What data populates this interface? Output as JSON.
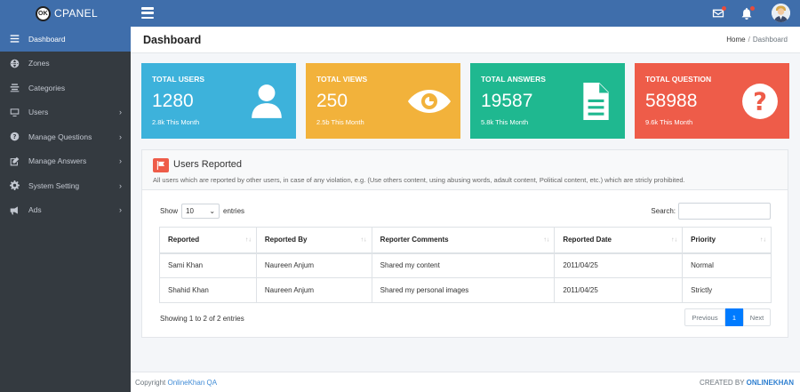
{
  "brand": {
    "logo_text": "OK",
    "name": "CPANEL"
  },
  "sidebar": {
    "items": [
      {
        "label": "Dashboard",
        "icon": "menu-icon",
        "arrow": ""
      },
      {
        "label": "Zones",
        "icon": "globe-icon",
        "arrow": ""
      },
      {
        "label": "Categories",
        "icon": "list-icon",
        "arrow": ""
      },
      {
        "label": "Users",
        "icon": "monitor-icon",
        "arrow": "›"
      },
      {
        "label": "Manage Questions",
        "icon": "question-icon",
        "arrow": "›"
      },
      {
        "label": "Manage Answers",
        "icon": "edit-icon",
        "arrow": "›"
      },
      {
        "label": "System Setting",
        "icon": "gear-icon",
        "arrow": "›"
      },
      {
        "label": "Ads",
        "icon": "bullhorn-icon",
        "arrow": "›"
      }
    ]
  },
  "header": {
    "title": "Dashboard",
    "breadcrumb_home": "Home",
    "breadcrumb_sep": "/",
    "breadcrumb_current": "Dashboard"
  },
  "cards": [
    {
      "label": "TOTAL USERS",
      "value": "1280",
      "sub": "2.8k This Month",
      "color": "#3db2db",
      "icon": "user-icon"
    },
    {
      "label": "TOTAL VIEWS",
      "value": "250",
      "sub": "2.5b This Month",
      "color": "#f2b23b",
      "icon": "eye-icon"
    },
    {
      "label": "TOTAL ANSWERS",
      "value": "19587",
      "sub": "5.8k This Month",
      "color": "#1fb890",
      "icon": "document-icon"
    },
    {
      "label": "TOTAL QUESTION",
      "value": "58988",
      "sub": "9.6k This Month",
      "color": "#ee5c49",
      "icon": "question-circle-icon"
    }
  ],
  "reported": {
    "title": "Users Reported",
    "description": "All users which are reported by other users, in case of any violation, e.g. (Use others content, using abusing words, adault content, Political content, etc.) which are stricly prohibited.",
    "show_label": "Show",
    "entries_value": "10",
    "entries_label": "entries",
    "search_label": "Search:",
    "columns": [
      "Reported",
      "Reported By",
      "Reporter Comments",
      "Reported Date",
      "Priority"
    ],
    "sort_glyph": "↑↓",
    "rows": [
      [
        "Sami Khan",
        "Naureen Anjum",
        "Shared my content",
        "2011/04/25",
        "Normal"
      ],
      [
        "Shahid Khan",
        "Naureen Anjum",
        "Shared my personal images",
        "2011/04/25",
        "Strictly"
      ]
    ],
    "info": "Showing 1 to 2 of 2 entries",
    "pager": {
      "prev": "Previous",
      "page": "1",
      "next": "Next"
    }
  },
  "footer": {
    "copyright_prefix": "Copyright ",
    "copyright_link": "OnlineKhan QA",
    "created_prefix": "CREATED BY ",
    "created_brand": "ONLINEKHAN"
  }
}
